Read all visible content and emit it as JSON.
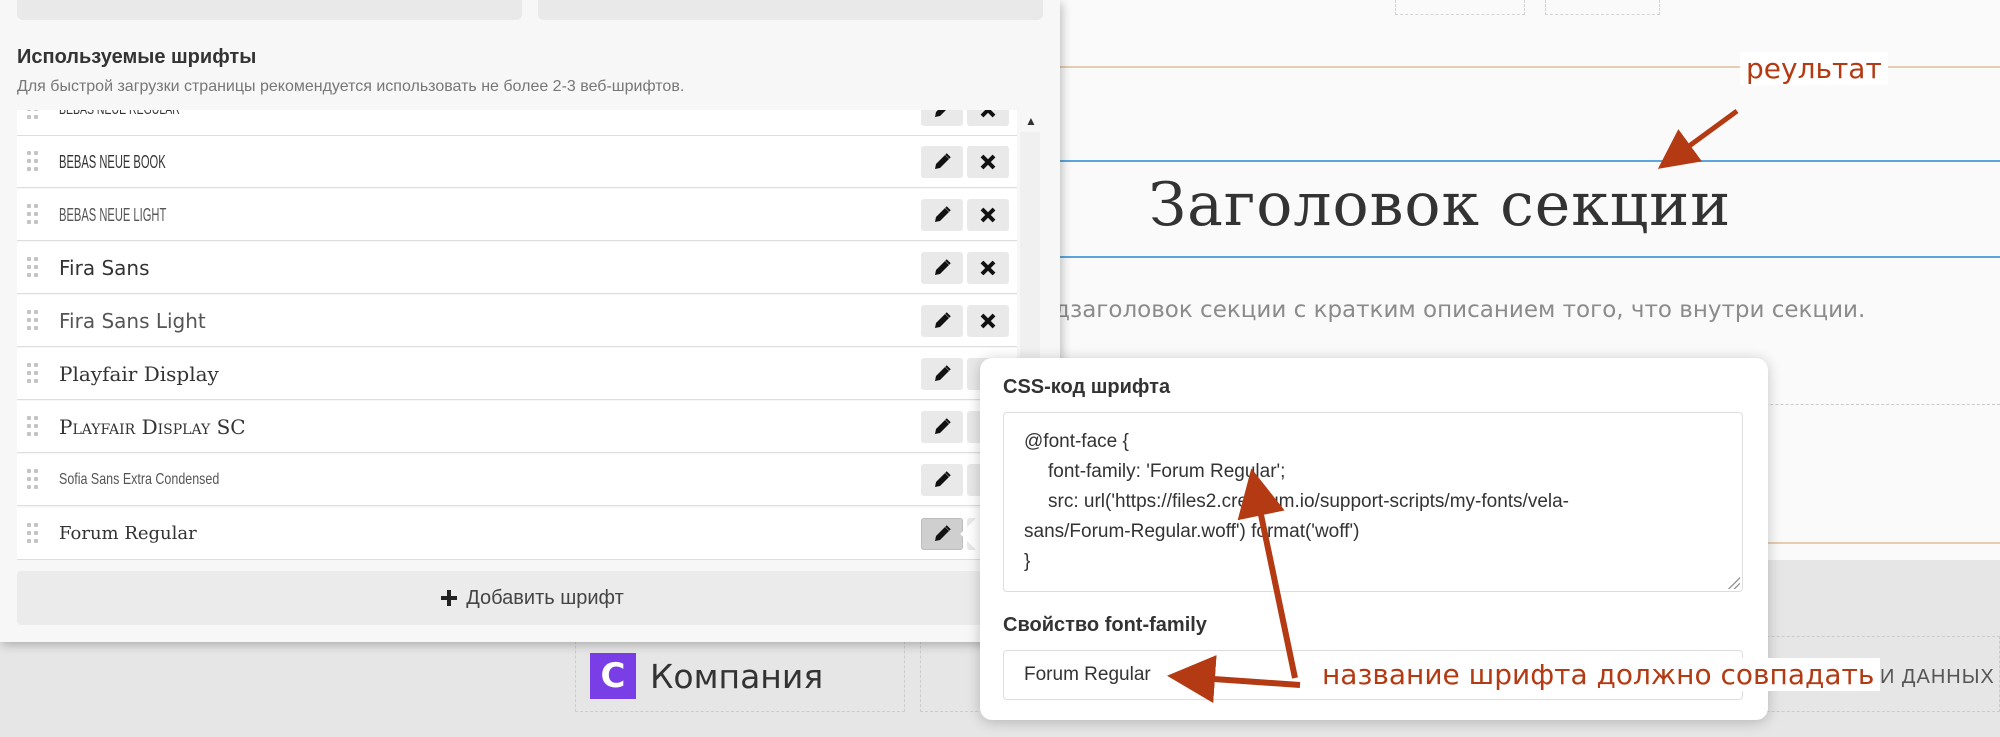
{
  "panel": {
    "title": "Используемые шрифты",
    "hint": "Для быстрой загрузки страницы рекомендуется использовать не более 2-3 веб-шрифтов.",
    "fonts": [
      "BEBAS NEUE REGULAR",
      "BEBAS NEUE BOOK",
      "BEBAS NEUE LIGHT",
      "Fira Sans",
      "Fira Sans Light",
      "Playfair Display",
      "Playfair Display SC",
      "Sofia Sans Extra Condensed",
      "Forum Regular"
    ],
    "add_button": "Добавить шрифт"
  },
  "popup": {
    "css_label": "CSS-код шрифта",
    "code_lines": [
      "@font-face {",
      "font-family: 'Forum Regular';",
      "src: url('https://files2.creatium.io/support-scripts/my-fonts/vela-",
      "sans/Forum-Regular.woff') format('woff')",
      "}"
    ],
    "family_label": "Свойство font-family",
    "family_value": "Forum Regular"
  },
  "background": {
    "section_title": "Заголовок секции",
    "section_subtitle": "одзаголовок секции с кратким описанием того, что внутри секции.",
    "company_logo": "C",
    "company_name": "Компания",
    "right_text": "И ДАННЫХ"
  },
  "annotations": {
    "result": "реультат",
    "name_match": "название шрифта должно совпадать",
    "color": "#b33a12"
  },
  "icons": {
    "edit": "pencil-icon",
    "delete": "close-icon",
    "add": "plus-icon",
    "drag": "drag-handle-icon"
  }
}
